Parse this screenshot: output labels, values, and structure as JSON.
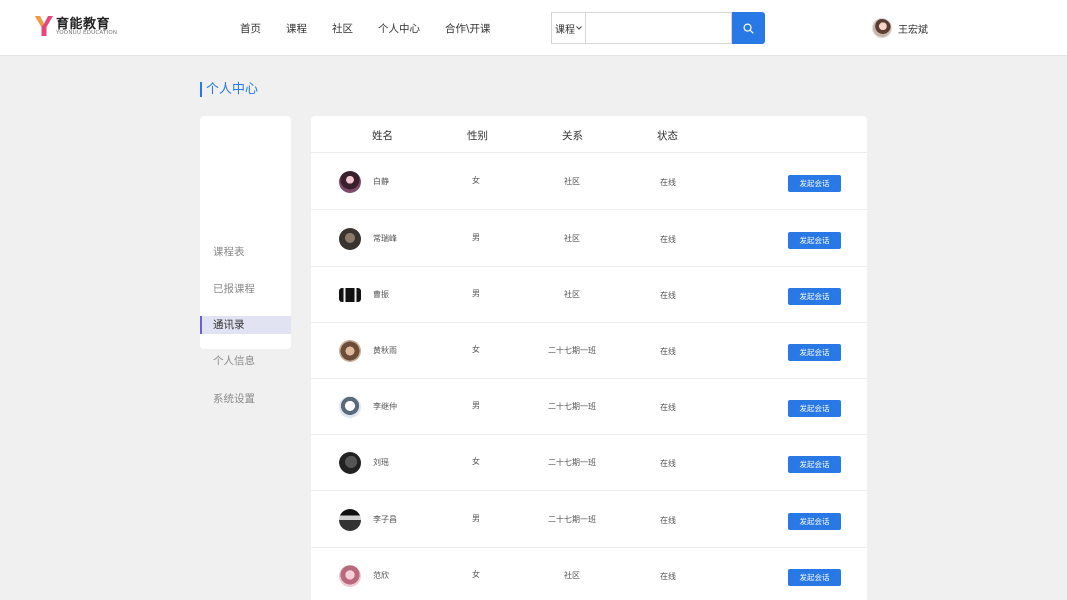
{
  "brand": {
    "title": "育能教育",
    "subtitle": "YOONUU EDUCATION"
  },
  "nav": [
    "首页",
    "课程",
    "社区",
    "个人中心",
    "合作\\开课"
  ],
  "search": {
    "category": "课程",
    "placeholder": ""
  },
  "user": {
    "name": "王宏斌"
  },
  "page_title": "个人中心",
  "sidebar": {
    "items": [
      {
        "label": "课程表"
      },
      {
        "label": "已报课程"
      },
      {
        "label": "通讯录"
      },
      {
        "label": "个人信息"
      },
      {
        "label": "系统设置"
      }
    ],
    "active_index": 2
  },
  "table": {
    "headers": [
      "姓名",
      "性别",
      "关系",
      "状态"
    ],
    "action_label": "发起会话",
    "rows": [
      {
        "name": "白静",
        "gender": "女",
        "relation": "社区",
        "status": "在线"
      },
      {
        "name": "常瑞峰",
        "gender": "男",
        "relation": "社区",
        "status": "在线"
      },
      {
        "name": "曹振",
        "gender": "男",
        "relation": "社区",
        "status": "在线"
      },
      {
        "name": "黄秋雨",
        "gender": "女",
        "relation": "二十七期一班",
        "status": "在线"
      },
      {
        "name": "李继仲",
        "gender": "男",
        "relation": "二十七期一班",
        "status": "在线"
      },
      {
        "name": "刘瑶",
        "gender": "女",
        "relation": "二十七期一班",
        "status": "在线"
      },
      {
        "name": "李子昌",
        "gender": "男",
        "relation": "二十七期一班",
        "status": "在线"
      },
      {
        "name": "范欣",
        "gender": "女",
        "relation": "社区",
        "status": "在线"
      }
    ]
  },
  "colors": {
    "accent": "#2878e6",
    "sidebar_active_bg": "#e1e2f2",
    "sidebar_active_bar": "#6f5fd6",
    "logo": "#e8457a"
  }
}
